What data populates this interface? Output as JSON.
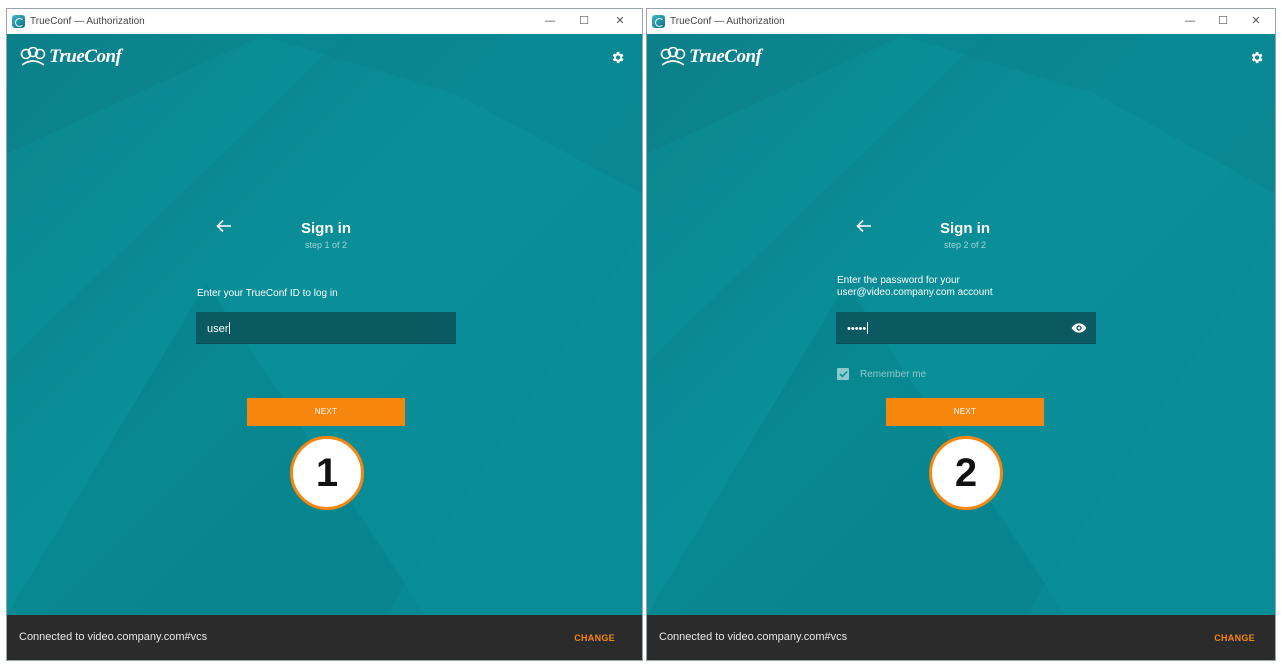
{
  "colors": {
    "accent": "#f7860f",
    "teal": "#0a8f99",
    "footer": "#2b2b2b"
  },
  "windows": [
    {
      "window_title": "TrueConf — Authorization",
      "logo_text": "TrueConf",
      "heading": "Sign in",
      "step": "step 1 of 2",
      "prompt_lines": [
        "Enter your TrueConf ID to log in"
      ],
      "field_value": "user",
      "next_label": "NEXT",
      "badge": "1",
      "connected_text": "Connected to video.company.com#vcs",
      "change_label": "CHANGE"
    },
    {
      "window_title": "TrueConf — Authorization",
      "logo_text": "TrueConf",
      "heading": "Sign in",
      "step": "step 2 of 2",
      "prompt_lines": [
        "Enter the password for your",
        "user@video.company.com account"
      ],
      "field_value": "•••••",
      "remember_label": "Remember me",
      "remember_checked": true,
      "next_label": "NEXT",
      "badge": "2",
      "connected_text": "Connected to video.company.com#vcs",
      "change_label": "CHANGE"
    }
  ]
}
